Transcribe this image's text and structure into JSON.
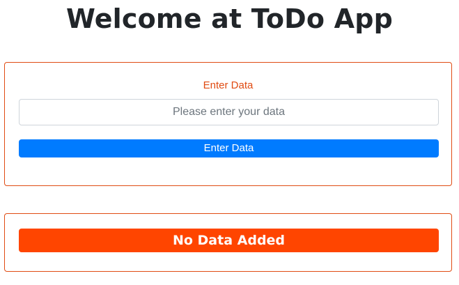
{
  "header": {
    "title": "Welcome at ToDo App"
  },
  "entry_form": {
    "label": "Enter Data",
    "input_value": "",
    "input_placeholder": "Please enter your data",
    "submit_label": "Enter Data"
  },
  "todo_list": {
    "empty_message": "No Data Added"
  },
  "colors": {
    "accent_border": "#e04b12",
    "primary_button": "#007bff",
    "empty_banner": "#ff4500"
  }
}
